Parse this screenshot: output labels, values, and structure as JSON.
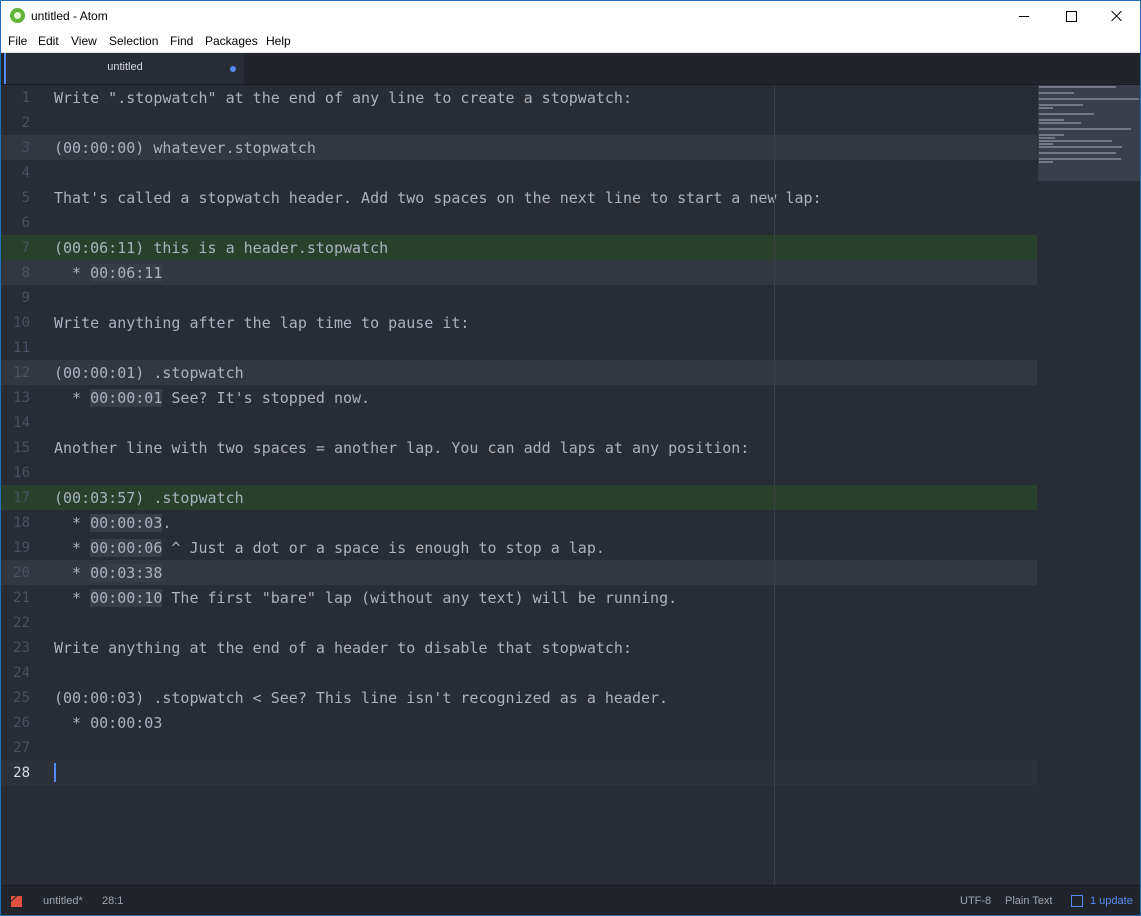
{
  "window": {
    "title": "untitled - Atom"
  },
  "menu": [
    "File",
    "Edit",
    "View",
    "Selection",
    "Find",
    "Packages",
    "Help"
  ],
  "tabs": [
    {
      "title": "untitled",
      "modified": true
    }
  ],
  "editor": {
    "lines": [
      {
        "n": "1",
        "text": "Write \".stopwatch\" at the end of any line to create a stopwatch:",
        "hl": ""
      },
      {
        "n": "2",
        "text": "",
        "hl": ""
      },
      {
        "n": "3",
        "text": "(00:00:00) whatever.stopwatch",
        "hl": "gray"
      },
      {
        "n": "4",
        "text": "",
        "hl": ""
      },
      {
        "n": "5",
        "text": "That's called a stopwatch header. Add two spaces on the next line to start a new lap:",
        "hl": ""
      },
      {
        "n": "6",
        "text": "",
        "hl": ""
      },
      {
        "n": "7",
        "text": "(00:06:11) this is a header.stopwatch",
        "hl": "green"
      },
      {
        "n": "8",
        "prefix": "  * ",
        "time": "00:06:11",
        "text": "",
        "hl": "gray"
      },
      {
        "n": "9",
        "text": "",
        "hl": ""
      },
      {
        "n": "10",
        "text": "Write anything after the lap time to pause it:",
        "hl": ""
      },
      {
        "n": "11",
        "text": "",
        "hl": ""
      },
      {
        "n": "12",
        "text": "(00:00:01) .stopwatch",
        "hl": "gray"
      },
      {
        "n": "13",
        "prefix": "  * ",
        "time": "00:00:01",
        "text": " See? It's stopped now.",
        "hl": ""
      },
      {
        "n": "14",
        "text": "",
        "hl": ""
      },
      {
        "n": "15",
        "text": "Another line with two spaces = another lap. You can add laps at any position:",
        "hl": ""
      },
      {
        "n": "16",
        "text": "",
        "hl": ""
      },
      {
        "n": "17",
        "text": "(00:03:57) .stopwatch",
        "hl": "green"
      },
      {
        "n": "18",
        "prefix": "  * ",
        "time": "00:00:03",
        "text": ".",
        "hl": ""
      },
      {
        "n": "19",
        "prefix": "  * ",
        "time": "00:00:06",
        "text": " ^ Just a dot or a space is enough to stop a lap.",
        "hl": ""
      },
      {
        "n": "20",
        "prefix": "  * ",
        "time": "00:03:38",
        "text": "",
        "hl": "gray"
      },
      {
        "n": "21",
        "prefix": "  * ",
        "time": "00:00:10",
        "text": " The first \"bare\" lap (without any text) will be running.",
        "hl": ""
      },
      {
        "n": "22",
        "text": "",
        "hl": ""
      },
      {
        "n": "23",
        "text": "Write anything at the end of a header to disable that stopwatch:",
        "hl": ""
      },
      {
        "n": "24",
        "text": "",
        "hl": ""
      },
      {
        "n": "25",
        "text": "(00:00:03) .stopwatch < See? This line isn't recognized as a header.",
        "hl": ""
      },
      {
        "n": "26",
        "text": "  * 00:00:03",
        "hl": ""
      },
      {
        "n": "27",
        "text": "",
        "hl": ""
      },
      {
        "n": "28",
        "text": "",
        "hl": "cursor"
      }
    ]
  },
  "status": {
    "file": "untitled*",
    "position": "28:1",
    "encoding": "UTF-8",
    "grammar": "Plain Text",
    "update": "1 update"
  },
  "colors": {
    "accent": "#568af2",
    "header_green": "#29402d",
    "header_gray": "#33373f"
  }
}
